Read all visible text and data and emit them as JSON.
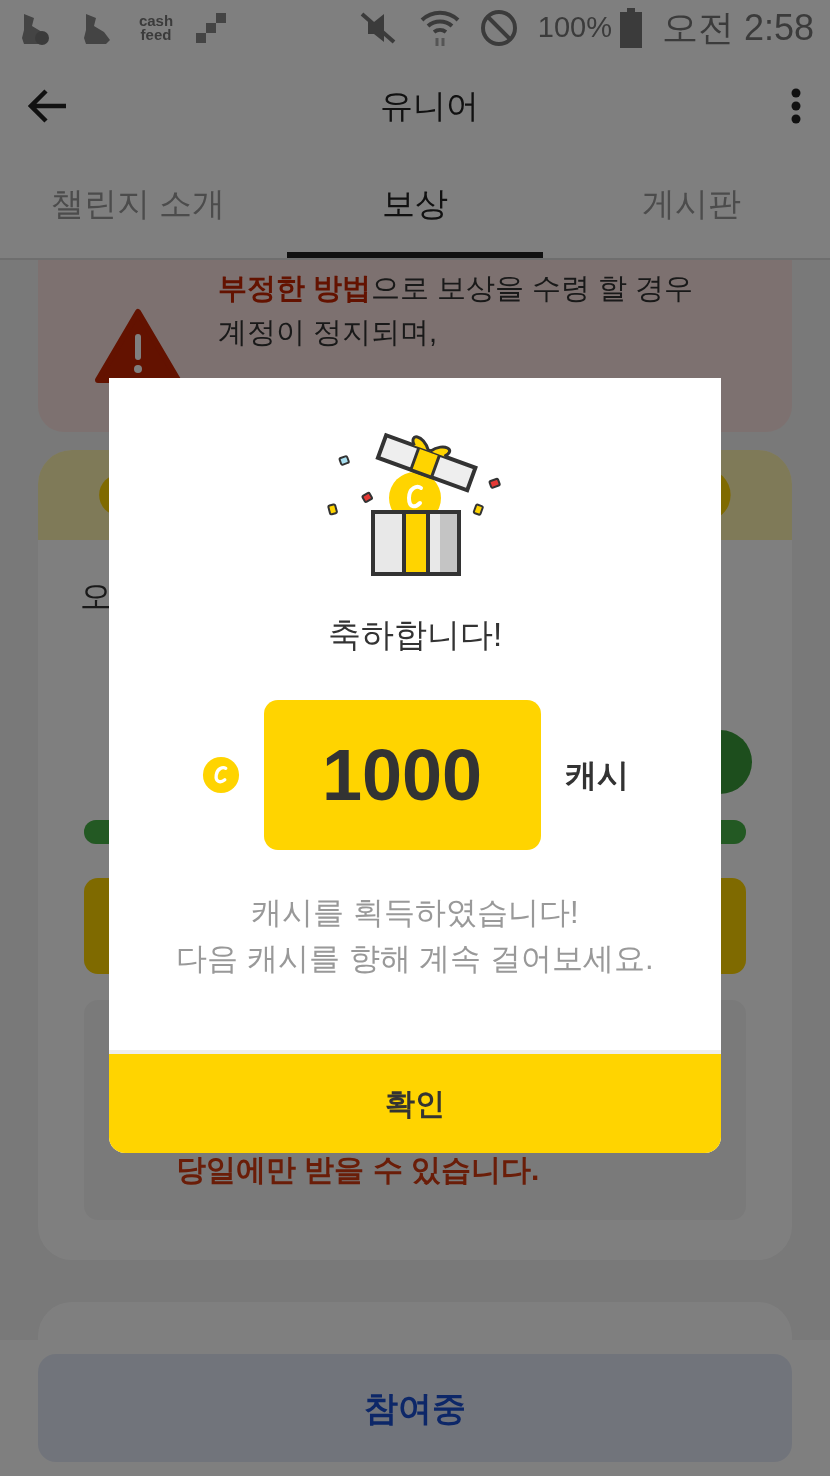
{
  "status_bar": {
    "app_icon_text": "cash feed",
    "battery": "100%",
    "time": "오전 2:58"
  },
  "app_bar": {
    "title": "유니어"
  },
  "tabs": [
    {
      "label": "챌린지 소개",
      "selected": false
    },
    {
      "label": "보상",
      "selected": true
    },
    {
      "label": "게시판",
      "selected": false
    }
  ],
  "warning": {
    "lines": [
      "**부정한 방법**으로 보상을 수령 할 경우",
      "계정이 정지되며,"
    ]
  },
  "reward_card": {
    "partial_text": "오",
    "progress": {
      "level": 1
    },
    "notice": "당일에만 받을 수 있습니다."
  },
  "bottom_button": {
    "label": "참여중"
  },
  "dialog": {
    "title": "축하합니다!",
    "amount": "1000",
    "unit": "캐시",
    "message_lines": [
      "캐시를 획득하였습니다!",
      "다음 캐시를 향해 계속 걸어보세요."
    ],
    "confirm": "확인"
  }
}
